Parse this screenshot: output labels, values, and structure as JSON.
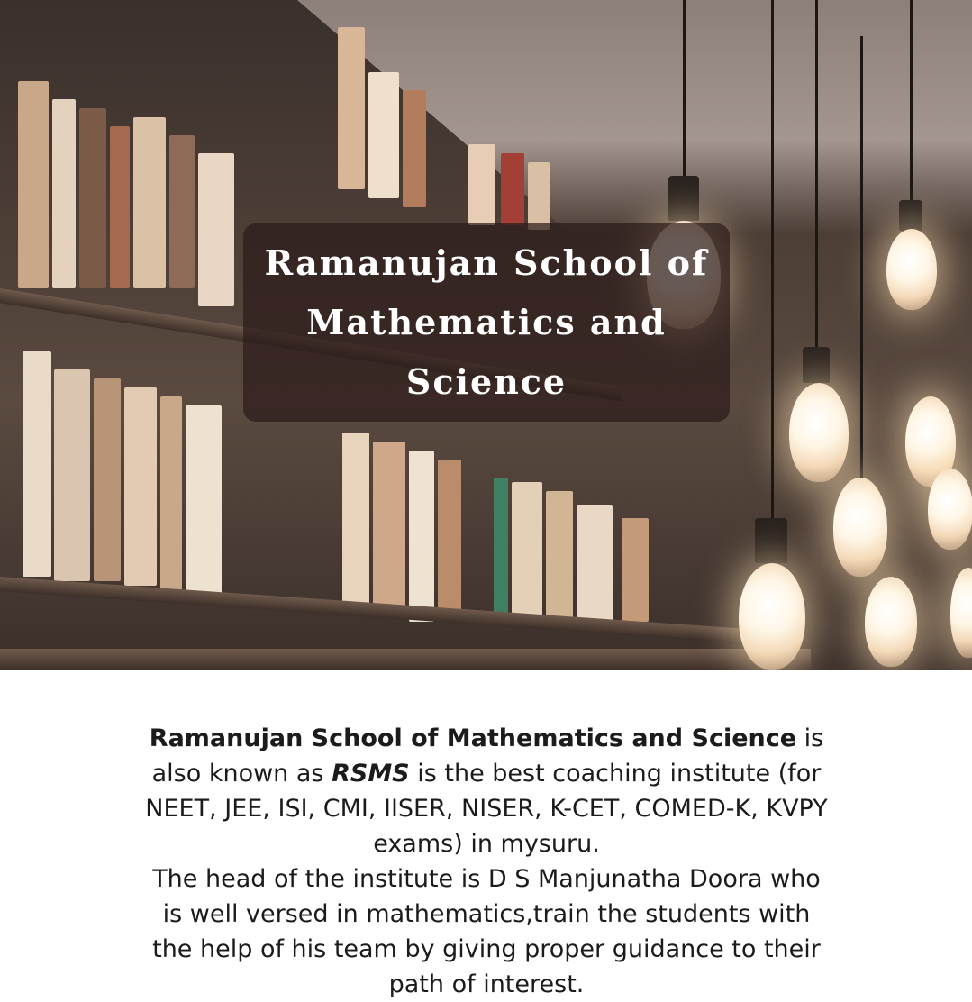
{
  "hero": {
    "title": "Ramanujan School of Mathematics and Science"
  },
  "description": {
    "school_name": "Ramanujan School of Mathematics and Science",
    "is": " is also known as ",
    "abbr": "RSMS",
    "para1_rest": " is the best coaching institute (for NEET, JEE, ISI, CMI, IISER, NISER, K-CET, COMED-K, KVPY exams) in mysuru.",
    "para2": "The head of the institute is D S Manjunatha Doora who is well versed in mathematics,train the students with the help of his team by giving proper guidance to their path of interest."
  },
  "colors": {
    "title_box": "#2d1c1a",
    "text": "#1b1b1b",
    "background": "#ffffff"
  }
}
